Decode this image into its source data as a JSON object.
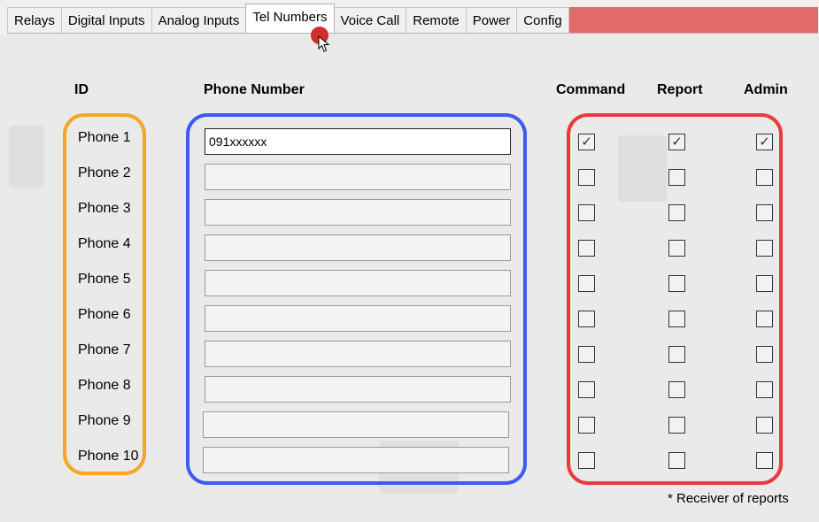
{
  "tabs": [
    {
      "label": "Relays",
      "active": false
    },
    {
      "label": "Digital Inputs",
      "active": false
    },
    {
      "label": "Analog Inputs",
      "active": false
    },
    {
      "label": "Tel Numbers",
      "active": true
    },
    {
      "label": "Voice Call",
      "active": false
    },
    {
      "label": "Remote",
      "active": false
    },
    {
      "label": "Power",
      "active": false
    },
    {
      "label": "Config",
      "active": false
    }
  ],
  "headers": {
    "id": "ID",
    "phone": "Phone Number",
    "command": "Command",
    "report": "Report",
    "admin": "Admin"
  },
  "rows": [
    {
      "id": "Phone 1",
      "number": "091xxxxxx",
      "command": true,
      "report": true,
      "admin": true
    },
    {
      "id": "Phone 2",
      "number": "",
      "command": false,
      "report": false,
      "admin": false
    },
    {
      "id": "Phone 3",
      "number": "",
      "command": false,
      "report": false,
      "admin": false
    },
    {
      "id": "Phone 4",
      "number": "",
      "command": false,
      "report": false,
      "admin": false
    },
    {
      "id": "Phone 5",
      "number": "",
      "command": false,
      "report": false,
      "admin": false
    },
    {
      "id": "Phone 6",
      "number": "",
      "command": false,
      "report": false,
      "admin": false
    },
    {
      "id": "Phone 7",
      "number": "",
      "command": false,
      "report": false,
      "admin": false
    },
    {
      "id": "Phone 8",
      "number": "",
      "command": false,
      "report": false,
      "admin": false
    },
    {
      "id": "Phone 9",
      "number": "",
      "command": false,
      "report": false,
      "admin": false
    },
    {
      "id": "Phone 10",
      "number": "",
      "command": false,
      "report": false,
      "admin": false
    }
  ],
  "footnote": "* Receiver of reports",
  "colors": {
    "id_box": "#f5a623",
    "phone_box": "#3d5af1",
    "check_box": "#e63c3c",
    "tab_strip": "#e36a6a",
    "cursor_dot": "#d42b2b"
  },
  "icons": {
    "check": "check-mark-icon",
    "cursor": "mouse-pointer-icon"
  }
}
